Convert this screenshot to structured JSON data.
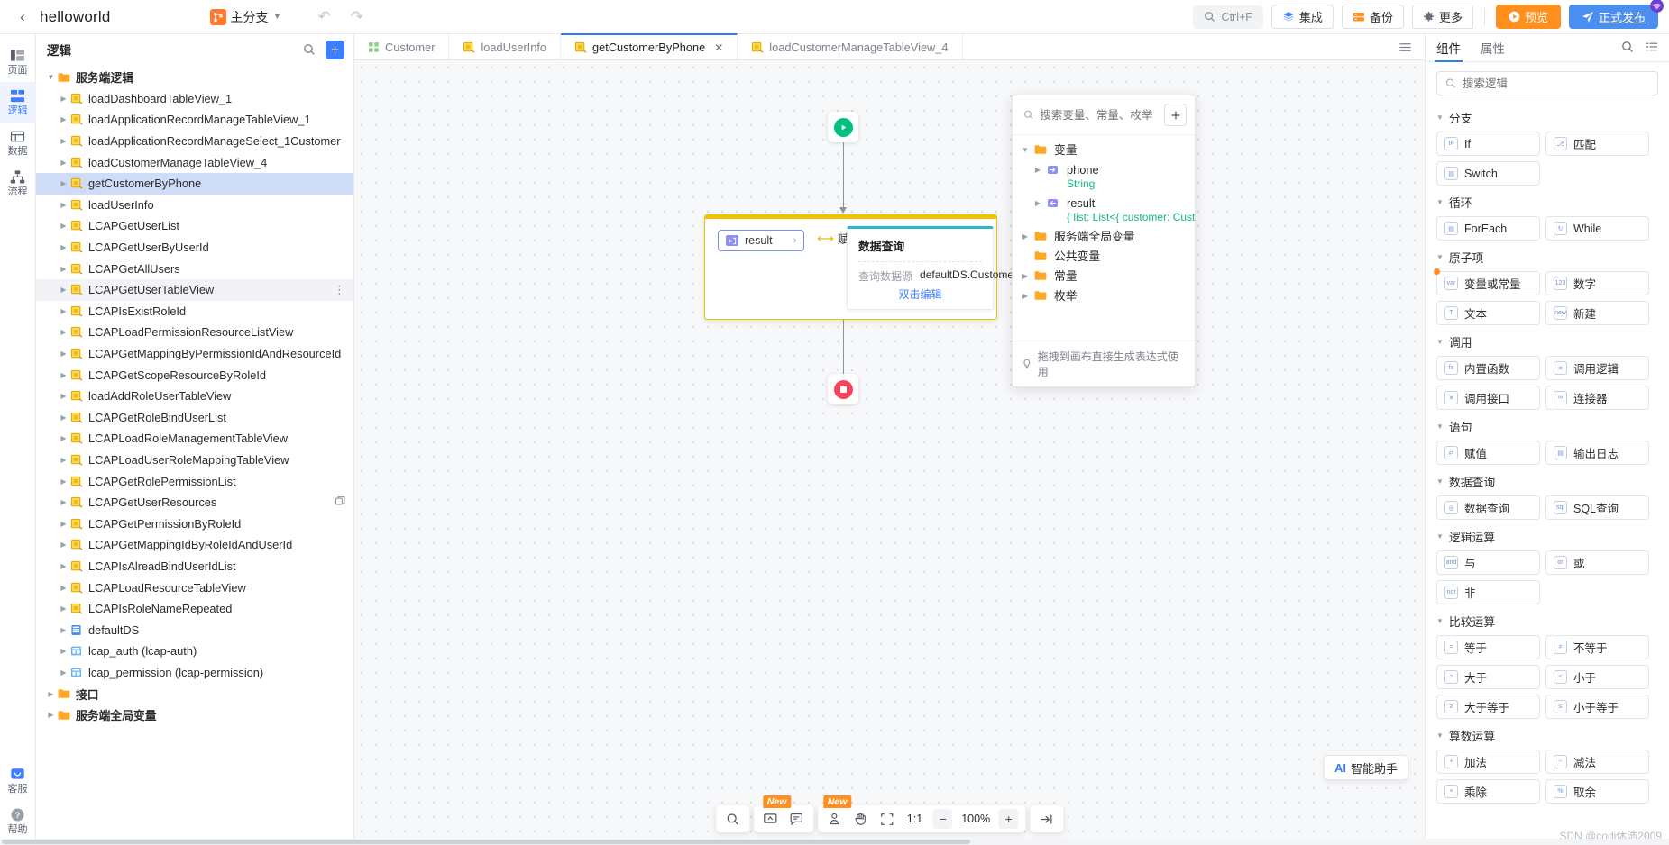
{
  "topbar": {
    "project_title": "helloworld",
    "branch_label": "主分支",
    "search_shortcut": "Ctrl+F",
    "integration_label": "集成",
    "backup_label": "备份",
    "more_label": "更多",
    "preview_label": "预览",
    "publish_label": "正式发布"
  },
  "rail": {
    "items": [
      {
        "label": "页面",
        "icon": "page-icon"
      },
      {
        "label": "逻辑",
        "icon": "logic-icon"
      },
      {
        "label": "数据",
        "icon": "data-icon"
      },
      {
        "label": "流程",
        "icon": "flow-icon"
      }
    ],
    "bottom_items": [
      {
        "label": "客服",
        "icon": "support-icon"
      },
      {
        "label": "帮助",
        "icon": "help-icon"
      }
    ]
  },
  "tree": {
    "title": "逻辑",
    "items": [
      {
        "label": "服务端逻辑",
        "type": "folder",
        "depth": 0,
        "expanded": true
      },
      {
        "label": "loadDashboardTableView_1",
        "type": "logic",
        "depth": 1
      },
      {
        "label": "loadApplicationRecordManageTableView_1",
        "type": "logic",
        "depth": 1
      },
      {
        "label": "loadApplicationRecordManageSelect_1Customer",
        "type": "logic",
        "depth": 1
      },
      {
        "label": "loadCustomerManageTableView_4",
        "type": "logic",
        "depth": 1
      },
      {
        "label": "getCustomerByPhone",
        "type": "logic",
        "depth": 1,
        "selected": true
      },
      {
        "label": "loadUserInfo",
        "type": "logic",
        "depth": 1
      },
      {
        "label": "LCAPGetUserList",
        "type": "logic",
        "depth": 1
      },
      {
        "label": "LCAPGetUserByUserId",
        "type": "logic",
        "depth": 1
      },
      {
        "label": "LCAPGetAllUsers",
        "type": "logic",
        "depth": 1
      },
      {
        "label": "LCAPGetUserTableView",
        "type": "logic",
        "depth": 1,
        "hovered": true,
        "trailing": "more"
      },
      {
        "label": "LCAPIsExistRoleId",
        "type": "logic",
        "depth": 1
      },
      {
        "label": "LCAPLoadPermissionResourceListView",
        "type": "logic",
        "depth": 1
      },
      {
        "label": "LCAPGetMappingByPermissionIdAndResourceId",
        "type": "logic",
        "depth": 1
      },
      {
        "label": "LCAPGetScopeResourceByRoleId",
        "type": "logic",
        "depth": 1
      },
      {
        "label": "loadAddRoleUserTableView",
        "type": "logic",
        "depth": 1
      },
      {
        "label": "LCAPGetRoleBindUserList",
        "type": "logic",
        "depth": 1
      },
      {
        "label": "LCAPLoadRoleManagementTableView",
        "type": "logic",
        "depth": 1
      },
      {
        "label": "LCAPLoadUserRoleMappingTableView",
        "type": "logic",
        "depth": 1
      },
      {
        "label": "LCAPGetRolePermissionList",
        "type": "logic",
        "depth": 1
      },
      {
        "label": "LCAPGetUserResources",
        "type": "logic",
        "depth": 1,
        "trailing": "copy"
      },
      {
        "label": "LCAPGetPermissionByRoleId",
        "type": "logic",
        "depth": 1
      },
      {
        "label": "LCAPGetMappingIdByRoleIdAndUserId",
        "type": "logic",
        "depth": 1
      },
      {
        "label": "LCAPIsAlreadBindUserIdList",
        "type": "logic",
        "depth": 1
      },
      {
        "label": "LCAPLoadResourceTableView",
        "type": "logic",
        "depth": 1
      },
      {
        "label": "LCAPIsRoleNameRepeated",
        "type": "logic",
        "depth": 1
      },
      {
        "label": "defaultDS",
        "type": "ds",
        "depth": 1
      },
      {
        "label": "lcap_auth (lcap-auth)",
        "type": "conn",
        "depth": 1
      },
      {
        "label": "lcap_permission (lcap-permission)",
        "type": "conn",
        "depth": 1
      },
      {
        "label": "接口",
        "type": "folder",
        "depth": 0
      },
      {
        "label": "服务端全局变量",
        "type": "folder",
        "depth": 0
      }
    ]
  },
  "tabs": {
    "items": [
      {
        "label": "Customer",
        "icon": "entity-icon",
        "active": false,
        "closable": false
      },
      {
        "label": "loadUserInfo",
        "icon": "logic-icon",
        "active": false,
        "closable": false
      },
      {
        "label": "getCustomerByPhone",
        "icon": "logic-icon",
        "active": true,
        "closable": true
      },
      {
        "label": "loadCustomerManageTableView_4",
        "icon": "logic-icon",
        "active": false,
        "closable": false
      }
    ]
  },
  "canvas": {
    "assign_node": {
      "variable": "result",
      "operator_label": "赋值"
    },
    "query_card": {
      "title": "数据查询",
      "field_label": "查询数据源",
      "field_value": "defaultDS.Customer",
      "edit_hint": "双击编辑"
    }
  },
  "var_popup": {
    "search_placeholder": "搜索变量、常量、枚举",
    "tree": [
      {
        "label": "变量",
        "type": "folder",
        "depth": 0,
        "expanded": true
      },
      {
        "label": "phone",
        "type": "var-in",
        "depth": 1,
        "subtype": "String"
      },
      {
        "label": "result",
        "type": "var-out",
        "depth": 1,
        "subtype": "{ list: List<{ customer: Custome"
      },
      {
        "label": "服务端全局变量",
        "type": "folder",
        "depth": 0
      },
      {
        "label": "公共变量",
        "type": "folder",
        "depth": 0,
        "leaf": true
      },
      {
        "label": "常量",
        "type": "folder",
        "depth": 0
      },
      {
        "label": "枚举",
        "type": "folder",
        "depth": 0
      }
    ],
    "footer_hint": "拖拽到画布直接生成表达式使用"
  },
  "ai_button": {
    "label": "智能助手"
  },
  "bottom_toolbar": {
    "new_badge": "New",
    "ratio_label": "1:1",
    "zoom_level": "100%",
    "minus": "−",
    "plus": "+"
  },
  "right_panel": {
    "tabs": [
      {
        "label": "组件",
        "active": true
      },
      {
        "label": "属性",
        "active": false
      }
    ],
    "search_placeholder": "搜索逻辑",
    "groups": [
      {
        "title": "分支",
        "items": [
          {
            "label": "If",
            "icon": "if"
          },
          {
            "label": "匹配",
            "icon": "match"
          },
          {
            "label": "Switch",
            "icon": "switch"
          }
        ]
      },
      {
        "title": "循环",
        "items": [
          {
            "label": "ForEach",
            "icon": "foreach"
          },
          {
            "label": "While",
            "icon": "while"
          }
        ]
      },
      {
        "title": "原子项",
        "items": [
          {
            "label": "变量或常量",
            "icon": "var",
            "dot": true
          },
          {
            "label": "数字",
            "icon": "123"
          },
          {
            "label": "文本",
            "icon": "txt"
          },
          {
            "label": "新建",
            "icon": "new"
          }
        ]
      },
      {
        "title": "调用",
        "items": [
          {
            "label": "内置函数",
            "icon": "fx"
          },
          {
            "label": "调用逻辑",
            "icon": "logic"
          },
          {
            "label": "调用接口",
            "icon": "api"
          },
          {
            "label": "连接器",
            "icon": "conn"
          }
        ]
      },
      {
        "title": "语句",
        "items": [
          {
            "label": "赋值",
            "icon": "assign"
          },
          {
            "label": "输出日志",
            "icon": "log"
          }
        ]
      },
      {
        "title": "数据查询",
        "items": [
          {
            "label": "数据查询",
            "icon": "dq"
          },
          {
            "label": "SQL查询",
            "icon": "sql"
          }
        ]
      },
      {
        "title": "逻辑运算",
        "items": [
          {
            "label": "与",
            "icon": "and"
          },
          {
            "label": "或",
            "icon": "or"
          },
          {
            "label": "非",
            "icon": "not"
          }
        ]
      },
      {
        "title": "比较运算",
        "items": [
          {
            "label": "等于",
            "icon": "eq"
          },
          {
            "label": "不等于",
            "icon": "ne"
          },
          {
            "label": "大于",
            "icon": "gt"
          },
          {
            "label": "小于",
            "icon": "lt"
          },
          {
            "label": "大于等于",
            "icon": "ge"
          },
          {
            "label": "小于等于",
            "icon": "le"
          }
        ]
      },
      {
        "title": "算数运算",
        "items": [
          {
            "label": "加法",
            "icon": "add"
          },
          {
            "label": "减法",
            "icon": "sub"
          },
          {
            "label": "乘除",
            "icon": "mul"
          },
          {
            "label": "取余",
            "icon": "mod"
          }
        ]
      }
    ]
  },
  "watermark": "SDN @codi休浩2009",
  "colors": {
    "accent_blue": "#2f7dfa",
    "orange": "#ff8f1f",
    "publish_blue": "#4a8ef0",
    "selected_row": "#cfdcf7",
    "node_yellow": "#f2c200",
    "node_cyan": "#25b7d3",
    "type_green": "#12b886"
  }
}
